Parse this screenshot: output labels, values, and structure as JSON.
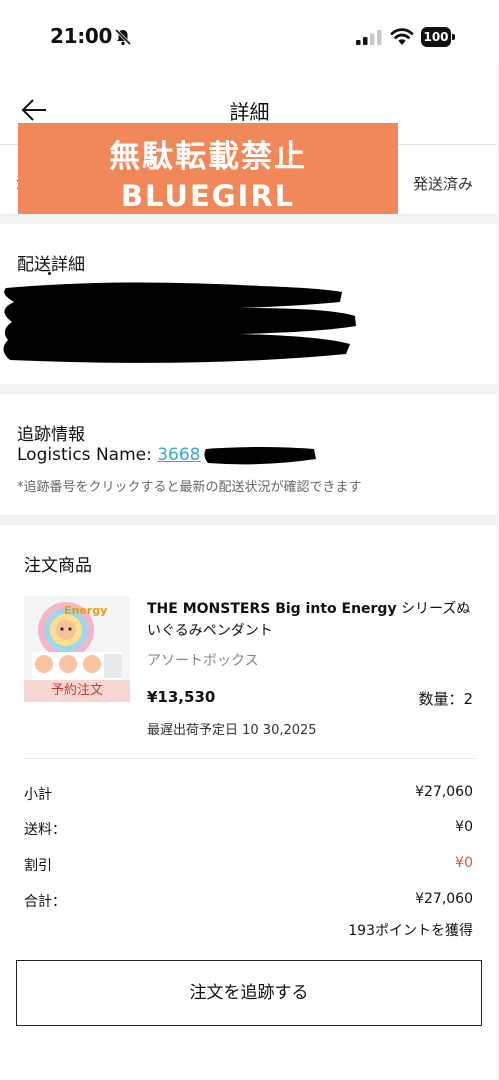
{
  "status_bar": {
    "time": "21:00",
    "battery": "100",
    "icons": [
      "bell-off-icon",
      "signal-icon",
      "wifi-icon",
      "battery-icon"
    ]
  },
  "header": {
    "title": "詳細",
    "back_icon": "arrow-left-icon"
  },
  "order_status": {
    "label": "注",
    "value": "発送済み"
  },
  "watermark": {
    "line1": "無駄転載禁止",
    "line2": "BLUEGIRL"
  },
  "delivery": {
    "title": "配送詳細"
  },
  "tracking": {
    "title": "追跡情報",
    "logistics_label": "Logistics Name: ",
    "tracking_number_visible": "3668",
    "note": "*追跡番号をクリックすると最新の配送状況が確認できます"
  },
  "items": {
    "title": "注文商品",
    "product": {
      "image_text": "Energy",
      "badge": "予約注文",
      "name_latin": "THE MONSTERS Big into Energy",
      "name_jp": " シリーズぬいぐるみペンダント",
      "variant": "アソートボックス",
      "price": "¥13,530",
      "quantity": "数量：2",
      "ship_date": "最遅出荷予定日 10 30,2025"
    }
  },
  "summary": {
    "subtotal_label": "小計",
    "subtotal_value": "¥27,060",
    "shipping_label": "送料：",
    "shipping_value": "¥0",
    "discount_label": "割引",
    "discount_value": "¥0",
    "total_label": "合計：",
    "total_value": "¥27,060",
    "points": "193ポイントを獲得"
  },
  "actions": {
    "track_order": "注文を追跡する"
  },
  "colors": {
    "watermark": "#f0885a",
    "link": "#3aa7c9",
    "discount": "#e0544b",
    "badge_bg": "#f6d7d3",
    "badge_text": "#c93b34"
  }
}
